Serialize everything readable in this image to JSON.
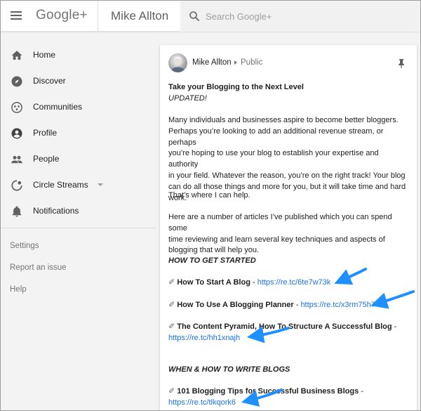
{
  "header": {
    "brand": "Google+",
    "page_title": "Mike Allton",
    "search_placeholder": "Search Google+"
  },
  "sidebar": {
    "items": [
      {
        "label": "Home",
        "icon": "home-icon"
      },
      {
        "label": "Discover",
        "icon": "compass-icon"
      },
      {
        "label": "Communities",
        "icon": "communities-icon"
      },
      {
        "label": "Profile",
        "icon": "profile-icon"
      },
      {
        "label": "People",
        "icon": "people-icon"
      },
      {
        "label": "Circle Streams",
        "icon": "circles-icon"
      },
      {
        "label": "Notifications",
        "icon": "bell-icon"
      }
    ],
    "footer_links": [
      "Settings",
      "Report an issue",
      "Help"
    ]
  },
  "post": {
    "author": "Mike Allton",
    "visibility": "Public",
    "title": "Take your Blogging to the Next Level",
    "updated": "UPDATED!",
    "para1_lines": [
      "Many individuals and businesses aspire to become better bloggers.",
      "Perhaps you’re looking to add an additional revenue stream, or perhaps",
      "you’re hoping to use your blog to establish your expertise and authority",
      "in your field. Whatever the reason, you’re on the right track! Your blog",
      "can do all those things and more for you, but it will take time and hard",
      "work."
    ],
    "para2": "That’s where I can help.",
    "para3_lines": [
      "Here are a number of articles I’ve published which you can spend some",
      "time reviewing and learn several key techniques and aspects of",
      "blogging that will help you."
    ],
    "section1": "HOW TO GET STARTED",
    "section2": "WHEN & HOW TO WRITE BLOGS",
    "pencil": "✐",
    "dash": " - ",
    "articles": [
      {
        "title": "How To Start A Blog",
        "url": "https://re.tc/6te7w73k"
      },
      {
        "title": "How To Use A Blogging Planner",
        "url": "https://re.tc/x3rm75h7"
      },
      {
        "title": "The Content Pyramid, How To Structure A Successful Blog",
        "url": "https://re.tc/hh1xnajh"
      },
      {
        "title": "101 Blogging Tips for Successful Business Blogs",
        "url": "https://re.tc/tlkqork6"
      }
    ]
  },
  "colors": {
    "link": "#1a73e8",
    "annotation_arrow": "#1e90ff"
  }
}
